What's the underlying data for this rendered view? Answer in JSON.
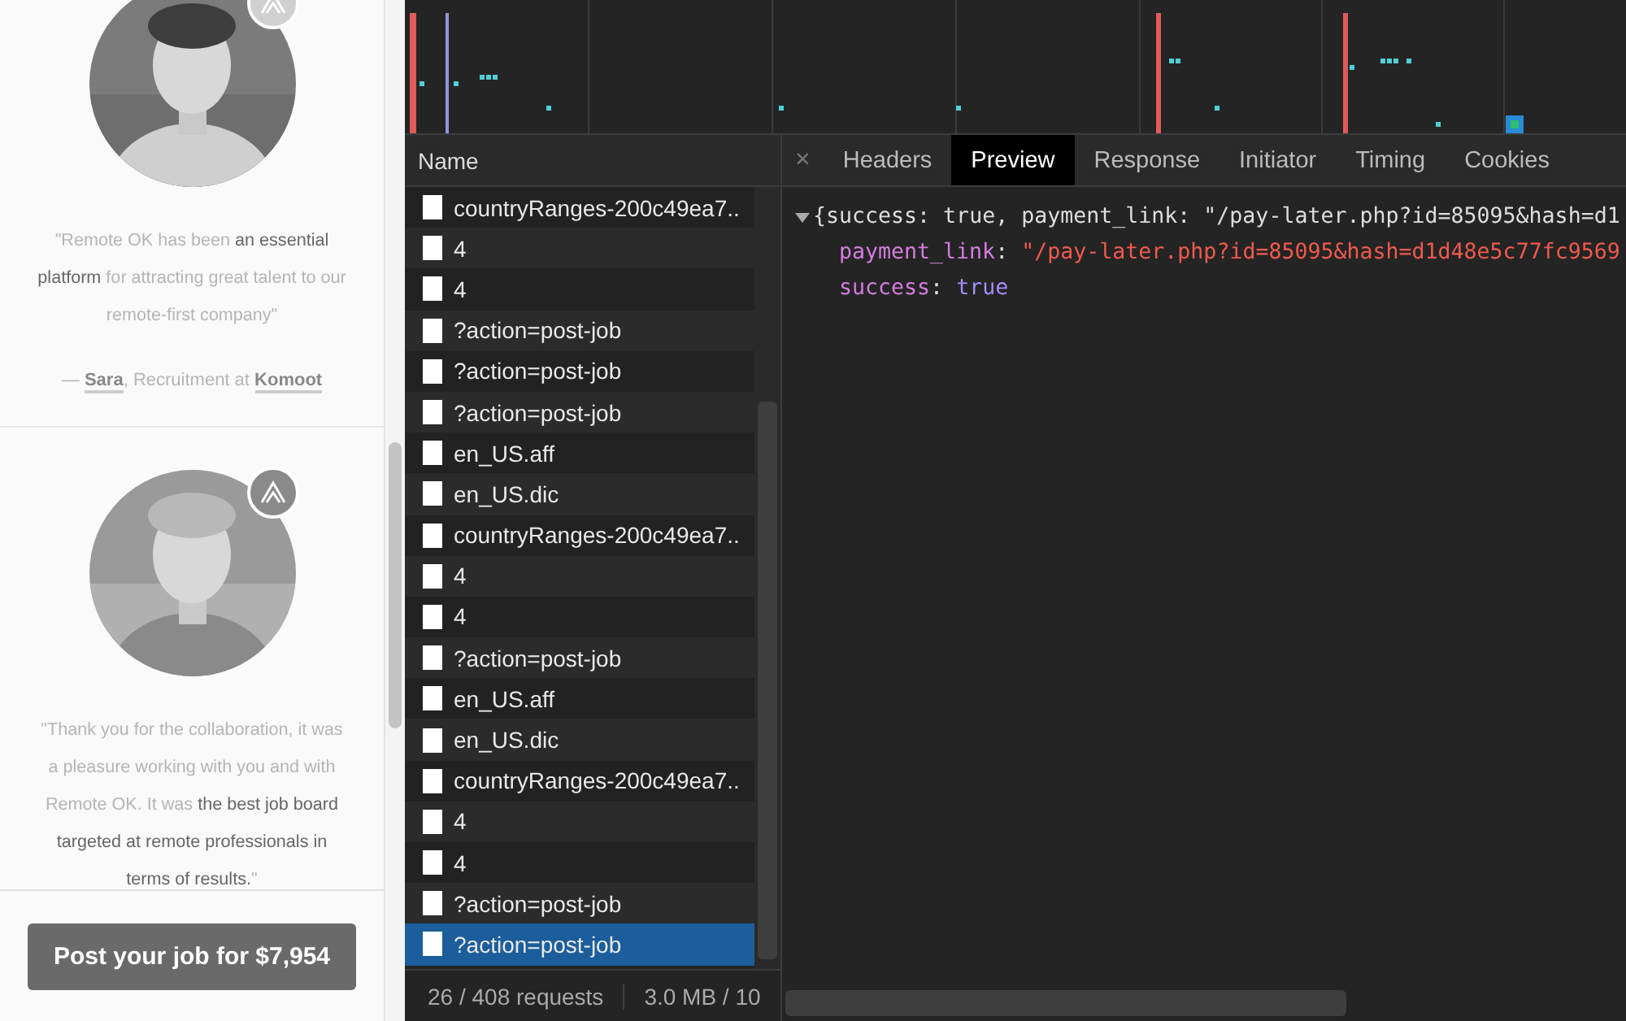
{
  "testimonials": [
    {
      "kind": "picture",
      "quote": "\"Remote OK has been **an essential platform** for attracting great talent to our remote-first company\"",
      "attribution": {
        "prefix": "— ",
        "person": "Sara",
        "middle": ", Recruitment at ",
        "company": "Komoot"
      }
    },
    {
      "kind": "picture",
      "quote": "\"Thank you for the collaboration, it was a pleasure working with you and with Remote OK. It was **the best job board targeted at remote professionals in terms of results.**\""
    }
  ],
  "post_button": "Post your job for $7,954",
  "requests": {
    "header": "Name",
    "rows": [
      {
        "name": "countryRanges-200c49ea7..",
        "selected": false
      },
      {
        "name": "4",
        "selected": false
      },
      {
        "name": "4",
        "selected": false
      },
      {
        "name": "?action=post-job",
        "selected": false
      },
      {
        "name": "?action=post-job",
        "selected": false
      },
      {
        "name": "?action=post-job",
        "selected": false
      },
      {
        "name": "en_US.aff",
        "selected": false
      },
      {
        "name": "en_US.dic",
        "selected": false
      },
      {
        "name": "countryRanges-200c49ea7..",
        "selected": false
      },
      {
        "name": "4",
        "selected": false
      },
      {
        "name": "4",
        "selected": false
      },
      {
        "name": "?action=post-job",
        "selected": false
      },
      {
        "name": "en_US.aff",
        "selected": false
      },
      {
        "name": "en_US.dic",
        "selected": false
      },
      {
        "name": "countryRanges-200c49ea7..",
        "selected": false
      },
      {
        "name": "4",
        "selected": false
      },
      {
        "name": "4",
        "selected": false
      },
      {
        "name": "?action=post-job",
        "selected": false
      },
      {
        "name": "?action=post-job",
        "selected": true
      }
    ]
  },
  "status_bar": [
    "26 / 408 requests",
    "3.0 MB / 10"
  ],
  "detail": {
    "close": "×",
    "tabs": [
      {
        "label": "Headers",
        "selected": false
      },
      {
        "label": "Preview",
        "selected": true
      },
      {
        "label": "Response",
        "selected": false
      },
      {
        "label": "Initiator",
        "selected": false
      },
      {
        "label": "Timing",
        "selected": false
      },
      {
        "label": "Cookies",
        "selected": false
      }
    ],
    "preview": {
      "expanded": true,
      "summary": "{success: true, payment_link: \"/pay-later.php?id=85095&hash=d1",
      "properties": [
        {
          "key": "payment_link",
          "sep": ":",
          "value": "\"/pay-later.php?id=85095&hash=d1d48e5c77fc9569",
          "kind": "string"
        },
        {
          "key": "success",
          "sep": ":",
          "value": "true",
          "kind": "boolean"
        }
      ]
    }
  }
}
